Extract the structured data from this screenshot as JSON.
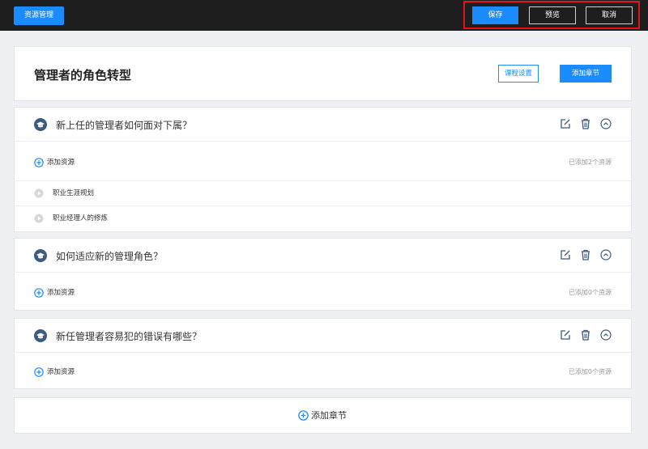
{
  "topbar": {
    "resource_manage": "资源管理",
    "save": "保存",
    "preview": "预览",
    "cancel": "取消"
  },
  "course": {
    "title": "管理者的角色转型",
    "settings_label": "课程设置",
    "add_chapter_label": "添加章节"
  },
  "chapters": [
    {
      "title": "新上任的管理者如何面对下属？",
      "add_resource": "添加资源",
      "count": "已添加2个资源",
      "resources": [
        "职业生涯规划",
        "职业经理人的修炼"
      ]
    },
    {
      "title": "如何适应新的管理角色？",
      "add_resource": "添加资源",
      "count": "已添加0个资源",
      "resources": []
    },
    {
      "title": "新任管理者容易犯的错误有哪些？",
      "add_resource": "添加资源",
      "count": "已添加0个资源",
      "resources": []
    }
  ],
  "footer": {
    "add_chapter": "添加章节"
  },
  "icons": {
    "chapter": "graduation-cap-icon",
    "edit": "edit-icon",
    "delete": "trash-icon",
    "collapse": "chevron-up-circle-icon",
    "add": "plus-circle-icon",
    "play": "play-circle-icon"
  },
  "colors": {
    "accent": "#1a8cff",
    "topbar": "#1e1e1e",
    "highlight": "#e0141b",
    "chapter_icon": "#3d5a80"
  }
}
